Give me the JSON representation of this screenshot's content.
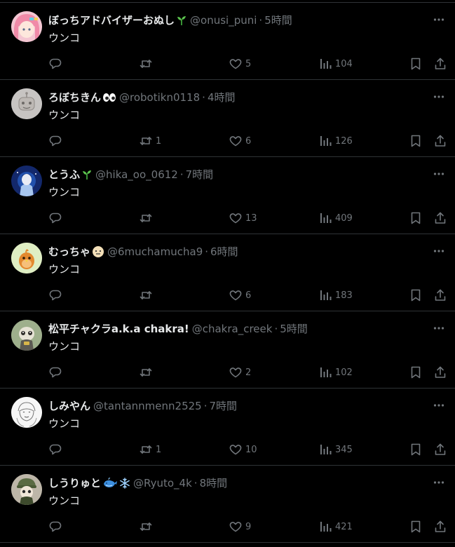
{
  "colors": {
    "background": "#000000",
    "primary_text": "#e7e9ea",
    "secondary_text": "#71767b",
    "divider": "#2f3336"
  },
  "tweets": [
    {
      "display_name": "ぼっちアドバイザーおぬし",
      "name_emojis": [
        "seedling-emoji"
      ],
      "handle": "@onusi_puni",
      "separator": "·",
      "time": "5時間",
      "text": "ウンコ",
      "reply_count": "",
      "retweet_count": "",
      "like_count": "5",
      "view_count": "104",
      "avatar": "pink-hair-anime-avatar"
    },
    {
      "display_name": "ろぼちきん",
      "name_emojis": [
        "eyes-emoji"
      ],
      "handle": "@robotikn0118",
      "separator": "·",
      "time": "4時間",
      "text": "ウンコ",
      "reply_count": "",
      "retweet_count": "1",
      "like_count": "6",
      "view_count": "126",
      "avatar": "grey-sketch-avatar"
    },
    {
      "display_name": "とうふ",
      "name_emojis": [
        "seedling-emoji"
      ],
      "handle": "@hika_oo_0612",
      "separator": "·",
      "time": "7時間",
      "text": "ウンコ",
      "reply_count": "",
      "retweet_count": "",
      "like_count": "13",
      "view_count": "409",
      "avatar": "blue-anime-avatar"
    },
    {
      "display_name": "むっちゃ",
      "name_emojis": [
        "face-emoji"
      ],
      "handle": "@6muchamucha9",
      "separator": "·",
      "time": "6時間",
      "text": "ウンコ",
      "reply_count": "",
      "retweet_count": "",
      "like_count": "6",
      "view_count": "183",
      "avatar": "orange-bird-avatar"
    },
    {
      "display_name": "松平チャクラa.k.a chakra!",
      "name_emojis": [],
      "handle": "@chakra_creek",
      "separator": "·",
      "time": "5時間",
      "text": "ウンコ",
      "reply_count": "",
      "retweet_count": "",
      "like_count": "2",
      "view_count": "102",
      "avatar": "green-character-avatar"
    },
    {
      "display_name": "しみやん",
      "name_emojis": [],
      "handle": "@tantannmenn2525",
      "separator": "·",
      "time": "7時間",
      "text": "ウンコ",
      "reply_count": "",
      "retweet_count": "1",
      "like_count": "10",
      "view_count": "345",
      "avatar": "line-drawing-avatar"
    },
    {
      "display_name": "しうりゅと",
      "name_emojis": [
        "whale-emoji",
        "snowflake-emoji"
      ],
      "handle": "@Ryuto_4k",
      "separator": "·",
      "time": "8時間",
      "text": "ウンコ",
      "reply_count": "",
      "retweet_count": "",
      "like_count": "9",
      "view_count": "421",
      "avatar": "green-hat-character-avatar"
    }
  ]
}
